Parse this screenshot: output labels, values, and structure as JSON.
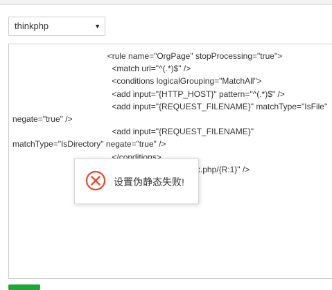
{
  "rewrite_select": {
    "value": "thinkphp"
  },
  "config_editor": {
    "content": "                                         <rule name=\"OrgPage\" stopProcessing=\"true\">\n                                           <match url=\"^(.*)$\" />\n                                           <conditions logicalGrouping=\"MatchAll\">\n                                           <add input=\"{HTTP_HOST}\" pattern=\"^(.*)$\" />\n                                           <add input=\"{REQUEST_FILENAME}\" matchType=\"IsFile\"\nnegate=\"true\" />\n                                           <add input=\"{REQUEST_FILENAME}\"\nmatchType=\"IsDirectory\" negate=\"true\" />\n                                           </conditions>\n                                                               \" url=\"index.php/{R:1}\" />"
  },
  "toast": {
    "message": "设置伪静态失败!",
    "icon": "error-circle-icon",
    "icon_color": "#e8492e"
  },
  "colors": {
    "border": "#cccccc",
    "submit_green": "#20a53a"
  }
}
